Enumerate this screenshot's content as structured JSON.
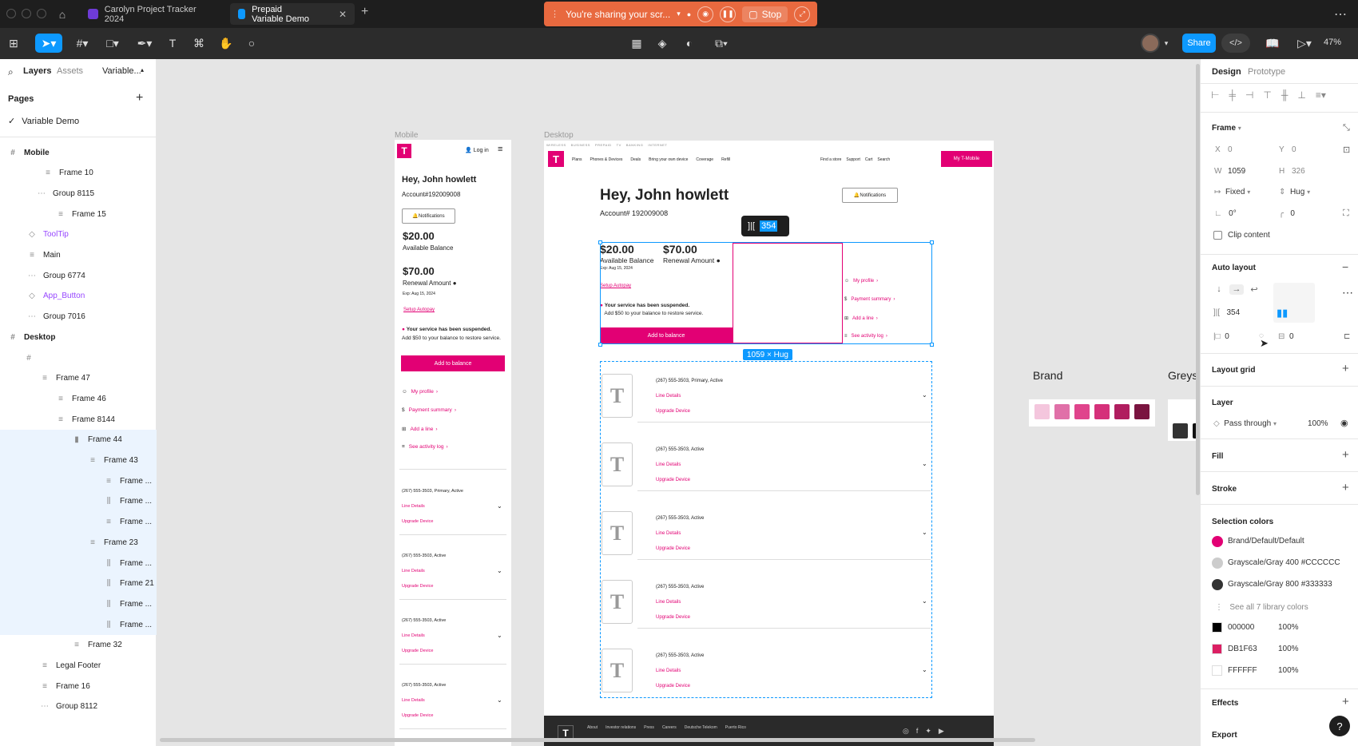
{
  "tabs": [
    {
      "label": "Carolyn Project Tracker 2024",
      "color": "#6e3bd6"
    },
    {
      "label": "Prepaid Variable Demo",
      "color": "#0d99ff"
    }
  ],
  "share": {
    "text": "You're sharing your scr...",
    "stop": "Stop"
  },
  "toolbar": {
    "share_label": "Share",
    "zoom": "47%"
  },
  "left_panel": {
    "tabs": [
      "Layers",
      "Assets",
      "Variable..."
    ],
    "pages_title": "Pages",
    "page": "Variable Demo",
    "layers": [
      "Mobile",
      "Frame 10",
      "Group 8115",
      "Frame 15",
      "ToolTip",
      "Main",
      "Group 6774",
      "App_Button",
      "Group 7016",
      "Desktop",
      "",
      "Frame 47",
      "Frame 46",
      "Frame 8144",
      "Frame 44",
      "Frame 43",
      "Frame ...",
      "Frame ...",
      "Frame ...",
      "Frame 23",
      "Frame ...",
      "Frame 21",
      "Frame ...",
      "Frame ...",
      "Frame 32",
      "Legal Footer",
      "Frame 16",
      "Group 8112"
    ]
  },
  "canvas": {
    "mobile_label": "Mobile",
    "desktop_label": "Desktop",
    "mobile": {
      "login": "Log in",
      "greeting": "Hey, John howlett",
      "account": "Account#192009008",
      "notifications": "Notifications",
      "balance": "$20.00",
      "balance_label": "Available Balance",
      "renewal": "$70.00",
      "renewal_label": "Renewal Amount",
      "exp": "Exp: Aug 15, 2024",
      "autopay": "Setup Autopay",
      "suspended_bold": "Your service has been suspended.",
      "suspended_rest": "Add $50 to your balance to restore service.",
      "add_balance": "Add to balance",
      "links": [
        "My profile",
        "Payment summary",
        "Add a line",
        "See activity log"
      ],
      "lines": [
        "(267) 555-3503, Primary, Active",
        "(267) 555-3503, Active",
        "(267) 555-3503, Active",
        "(267) 555-3503, Active"
      ],
      "line_details": "Line Details",
      "upgrade": "Upgrade Device"
    },
    "desktop": {
      "top_links": [
        "WIRELESS",
        "BUSINESS",
        "PREPAID",
        "TV",
        "BANKING",
        "INTERNET"
      ],
      "nav": [
        "Plans",
        "Phones & Devices",
        "Deals",
        "Bring your own device",
        "Coverage",
        "Refill"
      ],
      "nav_right": [
        "Find a store",
        "Support",
        "Cart",
        "Search"
      ],
      "mytmobile": "My T-Mobile",
      "greeting": "Hey, John howlett",
      "account": "Account# 192009008",
      "notifications": "Notifications",
      "balance": "$20.00",
      "balance_label": "Available Balance",
      "exp": "Exp: Aug 15, 2024",
      "renewal": "$70.00",
      "renewal_label": "Renewal Amount",
      "autopay": "Setup Autopay",
      "suspended_bold": "Your service has been suspended.",
      "suspended_rest": "Add $50 to your balance to restore service.",
      "add_balance": "Add to balance",
      "links": [
        "My profile",
        "Payment summary",
        "Add a line",
        "See activity log"
      ],
      "lines": [
        "(267) 555-3503, Primary, Active",
        "(267) 555-3503, Active",
        "(267) 555-3503, Active",
        "(267) 555-3503, Active",
        "(267) 555-3503, Active"
      ],
      "line_details": "Line Details",
      "upgrade": "Upgrade Device",
      "footer_links": [
        "About",
        "Investor relations",
        "Press",
        "Careers",
        "Deutsche Telekom",
        "Puerto Rico"
      ]
    },
    "gap_value": "354",
    "size_label": "1059 × Hug",
    "brand_label": "Brand",
    "greys_label": "Greys",
    "brand_swatches": [
      "#f4c6dd",
      "#e070a8",
      "#e0448c",
      "#d5307a",
      "#b01d5f",
      "#7a1440"
    ],
    "grey_swatches": [
      "#333333",
      "#111111"
    ]
  },
  "right_panel": {
    "tabs": [
      "Design",
      "Prototype"
    ],
    "frame_title": "Frame",
    "x_label": "X",
    "x_val": "0",
    "y_label": "Y",
    "y_val": "0",
    "w_label": "W",
    "w_val": "1059",
    "h_label": "H",
    "h_val": "326",
    "fixed": "Fixed",
    "hug": "Hug",
    "rotation": "0°",
    "radius": "0",
    "clip": "Clip content",
    "auto_layout": "Auto layout",
    "gap": "354",
    "pad_h": "0",
    "pad_v": "0",
    "layout_grid": "Layout grid",
    "layer_title": "Layer",
    "blend": "Pass through",
    "opacity": "100%",
    "fill": "Fill",
    "stroke": "Stroke",
    "selection_colors": "Selection colors",
    "colors": [
      {
        "name": "Brand/Default/Default",
        "hex": "#e20074"
      },
      {
        "name": "Grayscale/Gray 400 #CCCCCC",
        "hex": "#cccccc"
      },
      {
        "name": "Grayscale/Gray 800 #333333",
        "hex": "#333333"
      }
    ],
    "see_all": "See all 7 library colors",
    "hex_colors": [
      {
        "hex": "000000",
        "swatch": "#000000",
        "pct": "100%"
      },
      {
        "hex": "DB1F63",
        "swatch": "#db1f63",
        "pct": "100%"
      },
      {
        "hex": "FFFFFF",
        "swatch": "#ffffff",
        "pct": "100%"
      }
    ],
    "effects": "Effects",
    "export": "Export"
  }
}
